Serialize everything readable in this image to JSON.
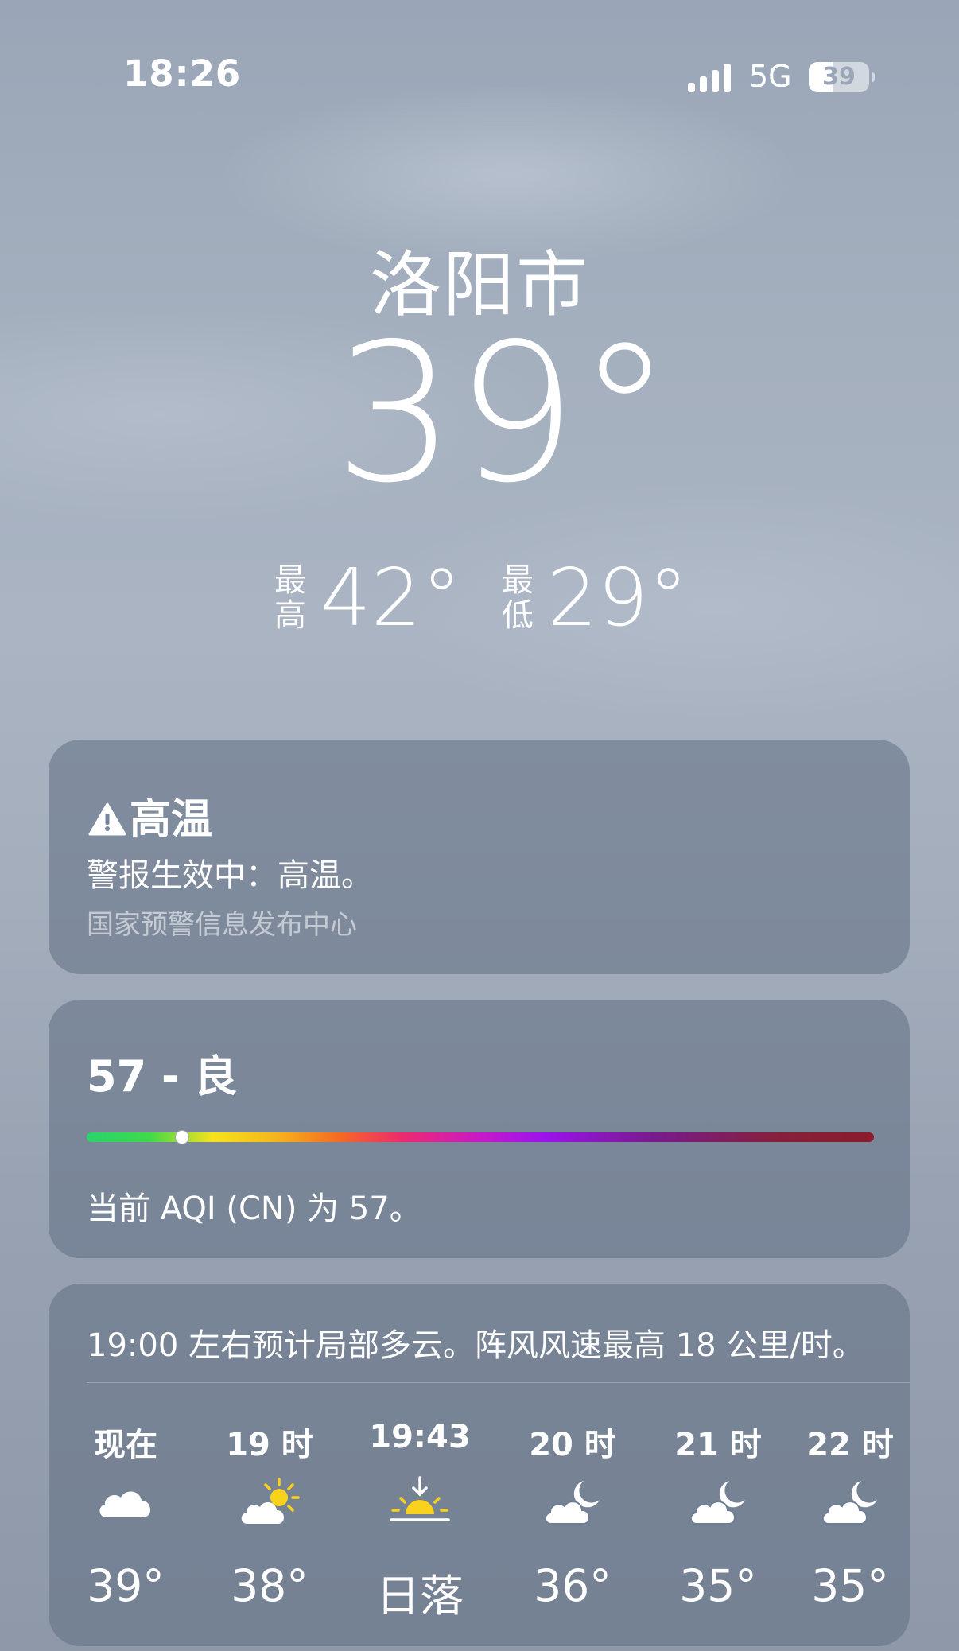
{
  "status_bar": {
    "time": "18:26",
    "network": "5G",
    "battery": "39",
    "battery_level": 0.39
  },
  "location": {
    "city": "洛阳市",
    "temperature": "39°",
    "high_label": "最高",
    "high": "42°",
    "low_label": "最低",
    "low": "29°"
  },
  "alert": {
    "title": "高温",
    "icon": "warning-triangle-icon",
    "body": "警报生效中：高温。",
    "source": "国家预警信息发布中心"
  },
  "aqi": {
    "title": "57 - 良",
    "value": 57,
    "level_fraction": 0.12,
    "description": "当前 AQI (CN) 为 57。"
  },
  "hourly": {
    "summary": "19:00 左右预计局部多云。阵风风速最高 18 公里/时。",
    "items": [
      {
        "label": "现在",
        "icon": "cloud-icon",
        "temp": "39°"
      },
      {
        "label": "19 时",
        "icon": "partly-sunny-icon",
        "temp": "38°"
      },
      {
        "label": "19:43",
        "icon": "sunset-icon",
        "temp": "日落"
      },
      {
        "label": "20 时",
        "icon": "partly-cloudy-night-icon",
        "temp": "36°"
      },
      {
        "label": "21 时",
        "icon": "partly-cloudy-night-icon",
        "temp": "35°"
      },
      {
        "label": "22 时",
        "icon": "partly-cloudy-night-icon",
        "temp": "35°"
      }
    ]
  },
  "colors": {
    "background": "#a3adbc",
    "card": "#607084",
    "sun": "#f8d21c"
  }
}
